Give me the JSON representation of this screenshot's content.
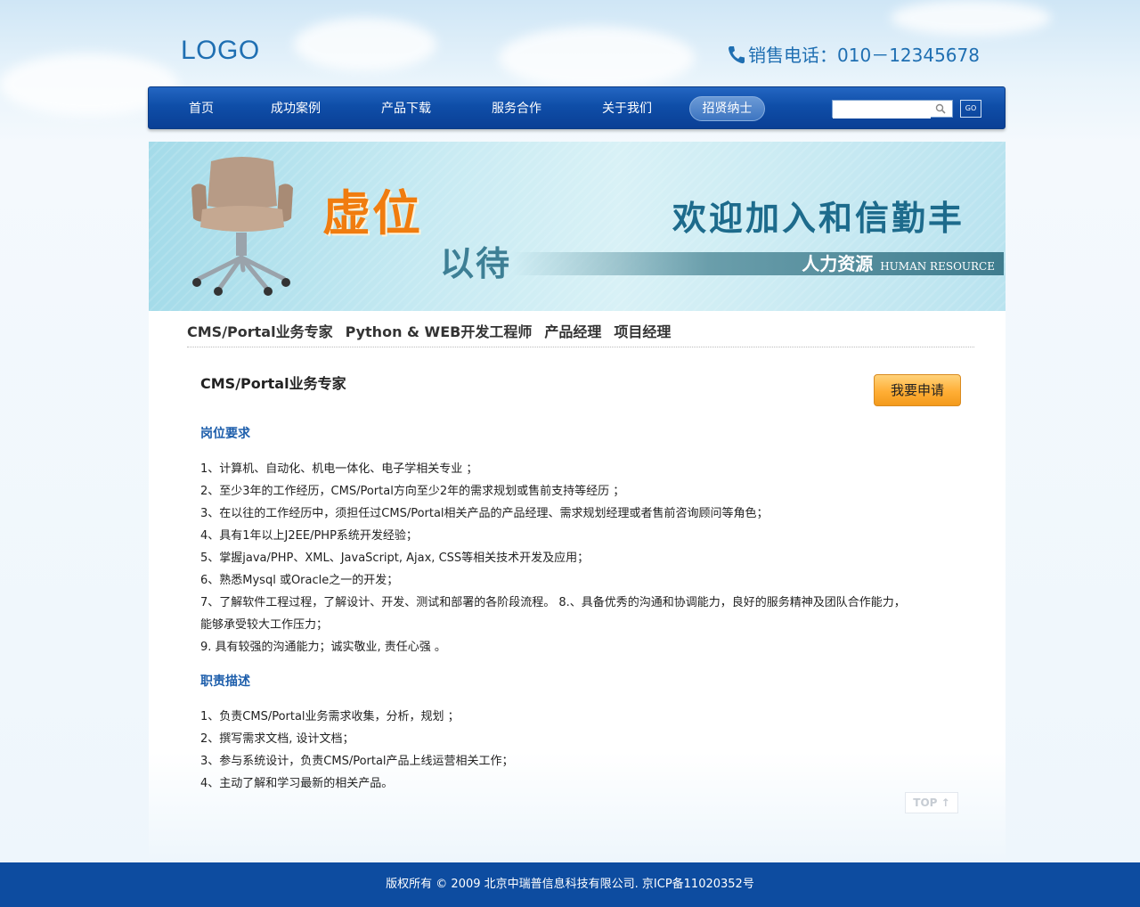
{
  "header": {
    "logo": "LOGO",
    "phone": "销售电话：010－12345678"
  },
  "nav": {
    "items": [
      {
        "label": "首页"
      },
      {
        "label": "成功案例"
      },
      {
        "label": "产品下载"
      },
      {
        "label": "服务合作"
      },
      {
        "label": "关于我们"
      },
      {
        "label": "招贤纳士"
      }
    ],
    "active": "招贤纳士",
    "search_placeholder": "",
    "go_label": "GO"
  },
  "banner": {
    "title_orange": "虚位",
    "title_teal": "以待",
    "headline": "欢迎加入和信勤丰",
    "subtitle_cn": "人力资源",
    "subtitle_en": "HUMAN RESOURCE"
  },
  "tabs": [
    {
      "label": "CMS/Portal业务专家"
    },
    {
      "label": "Python & WEB开发工程师"
    },
    {
      "label": "产品经理"
    },
    {
      "label": "项目经理"
    }
  ],
  "job": {
    "title": "CMS/Portal业务专家",
    "apply_label": "我要申请",
    "requirements_heading": "岗位要求",
    "requirements": [
      "1、计算机、自动化、机电一体化、电子学相关专业 ；",
      "2、至少3年的工作经历，CMS/Portal方向至少2年的需求规划或售前支持等经历 ；",
      "3、在以往的工作经历中，须担任过CMS/Portal相关产品的产品经理、需求规划经理或者售前咨询顾问等角色；",
      "4、具有1年以上J2EE/PHP系统开发经验；",
      "5、掌握java/PHP、XML、JavaScript, Ajax, CSS等相关技术开发及应用；",
      "6、熟悉Mysql 或Oracle之一的开发；",
      "7、了解软件工程过程，了解设计、开发、测试和部署的各阶段流程。 8.、具备优秀的沟通和协调能力，良好的服务精神及团队合作能力，",
      "能够承受较大工作压力；",
      "9. 具有较强的沟通能力；诚实敬业, 责任心强 。"
    ],
    "duties_heading": "职责描述",
    "duties": [
      "1、负责CMS/Portal业务需求收集，分析，规划 ；",
      "2、撰写需求文档, 设计文档；",
      "3、参与系统设计，负责CMS/Portal产品上线运营相关工作；",
      "4、主动了解和学习最新的相关产品。"
    ]
  },
  "top_button": "TOP",
  "footer": "版权所有 © 2009 北京中瑞普信息科技有限公司. 京ICP备11020352号"
}
